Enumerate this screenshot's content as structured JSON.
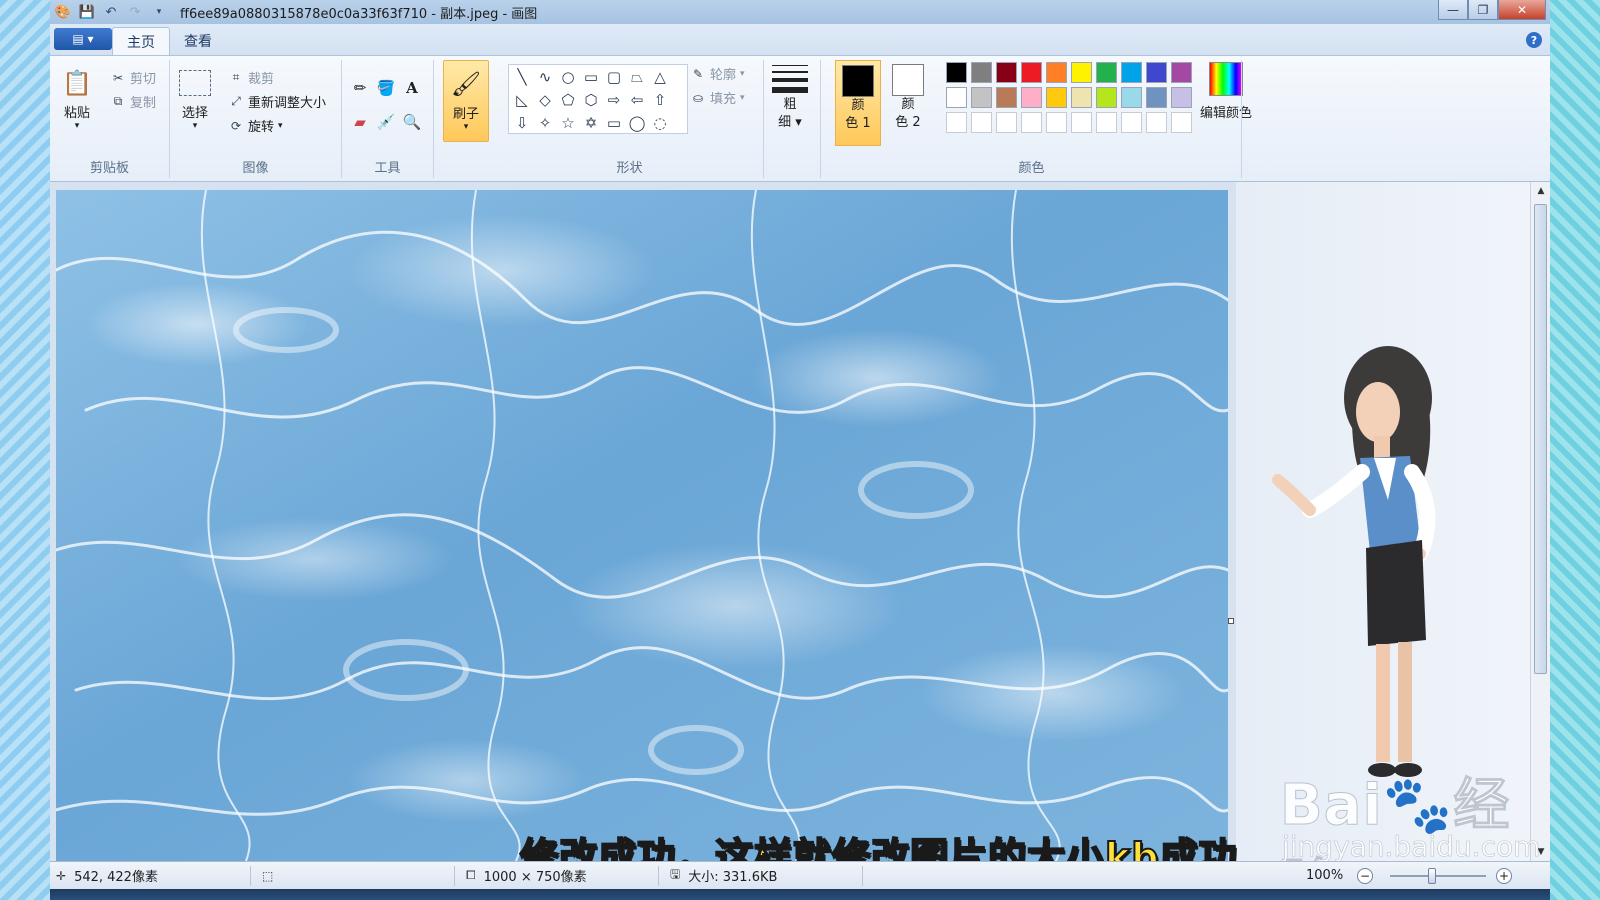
{
  "window": {
    "title": "ff6ee89a0880315878e0c0a33f63f710 - 副本.jpeg - 画图",
    "minimize": "—",
    "maximize": "❐",
    "close": "✕"
  },
  "tabs": [
    {
      "label": "主页",
      "active": true
    },
    {
      "label": "查看",
      "active": false
    }
  ],
  "clipboard": {
    "paste": "粘贴",
    "cut": "剪切",
    "copy": "复制",
    "group": "剪贴板"
  },
  "image": {
    "select": "选择",
    "crop": "裁剪",
    "resize": "重新调整大小",
    "rotate": "旋转",
    "group": "图像"
  },
  "tools": {
    "group": "工具",
    "text_tool": "A"
  },
  "brush": {
    "label": "刷子"
  },
  "shapes": {
    "outline": "轮廓",
    "fill": "填充",
    "group": "形状",
    "glyphs": [
      "╲",
      "∿",
      "○",
      "▭",
      "▢",
      "⏢",
      "△",
      "◺",
      "◇",
      "⬠",
      "⬡",
      "⇨",
      "⇦",
      "⇧",
      "⇩",
      "✧",
      "☆",
      "✡",
      "▭",
      "◯",
      "◌"
    ]
  },
  "size": {
    "label1": "粗",
    "label2": "细"
  },
  "colors": {
    "color1_label1": "颜",
    "color1_label2": "色 1",
    "color2_label1": "颜",
    "color2_label2": "色 2",
    "group": "颜色",
    "edit": "编辑颜色",
    "color1": "#000000",
    "color2": "#ffffff",
    "palette_row1": [
      "#000000",
      "#7f7f7f",
      "#880015",
      "#ed1c24",
      "#ff7f27",
      "#fff200",
      "#22b14c",
      "#00a2e8",
      "#3f48cc",
      "#a349a4"
    ],
    "palette_row2": [
      "#ffffff",
      "#c3c3c3",
      "#b97a57",
      "#ffaec9",
      "#ffc90e",
      "#efe4b0",
      "#b5e61d",
      "#99d9ea",
      "#7092be",
      "#c8bfe7"
    ],
    "palette_row3": [
      "#ffffff",
      "#ffffff",
      "#ffffff",
      "#ffffff",
      "#ffffff",
      "#ffffff",
      "#ffffff",
      "#ffffff",
      "#ffffff",
      "#ffffff"
    ]
  },
  "status": {
    "cursor": "542, 422像素",
    "dimensions": "1000 × 750像素",
    "filesize": "大小: 331.6KB",
    "zoom": "100%"
  },
  "subtitle": "修改成功，这样就修改图片的大小kb成功",
  "watermark": {
    "brand": "Bai",
    "brand_cn": "经验",
    "url": "jingyan.baidu.com"
  }
}
